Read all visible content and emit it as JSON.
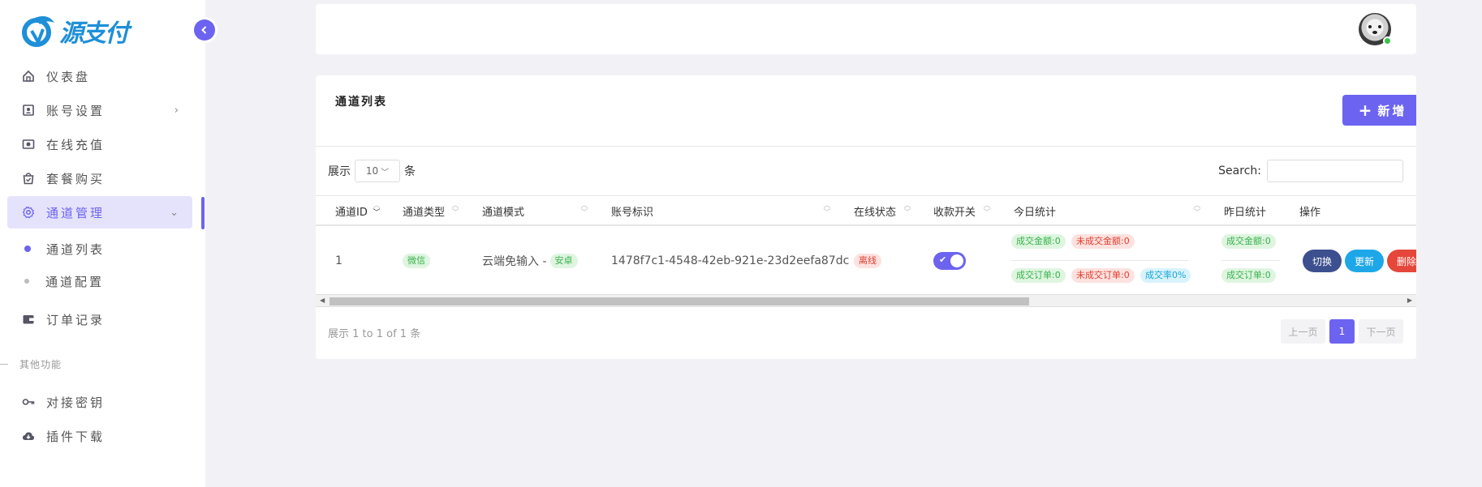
{
  "brand": {
    "logo_text": "源支付"
  },
  "sidebar": {
    "items": [
      {
        "label": "仪表盘",
        "icon": "home-icon"
      },
      {
        "label": "账号设置",
        "icon": "account-icon"
      },
      {
        "label": "在线充值",
        "icon": "recharge-icon"
      },
      {
        "label": "套餐购买",
        "icon": "shopping-bag-icon"
      },
      {
        "label": "通道管理",
        "icon": "gear-icon"
      }
    ],
    "sub_items": [
      {
        "label": "通道列表"
      },
      {
        "label": "通道配置"
      }
    ],
    "orders": {
      "label": "订单记录",
      "icon": "wallet-icon"
    },
    "section_label": "其他功能",
    "other_items": [
      {
        "label": "对接密钥",
        "icon": "key-icon"
      },
      {
        "label": "插件下载",
        "icon": "cloud-download-icon"
      }
    ]
  },
  "card": {
    "title": "通道列表",
    "add_label": "新增",
    "length_prefix": "展示",
    "length_value": "10",
    "length_suffix": "条",
    "search_label": "Search:",
    "search_value": ""
  },
  "table": {
    "columns": [
      "通道ID",
      "通道类型",
      "通道模式",
      "账号标识",
      "在线状态",
      "收款开关",
      "今日统计",
      "昨日统计",
      "操作"
    ],
    "rows": [
      {
        "id": "1",
        "type": "微信",
        "mode": "云端免输入 -",
        "mode_badge": "安卓",
        "account": "1478f7c1-4548-42eb-921e-23d2eefa87dc",
        "status": "离线",
        "switch_on": true,
        "today": {
          "amount": "成交金额:0",
          "unpaid_amount": "未成交金额:0",
          "orders": "成交订单:0",
          "unpaid_orders": "未成交订单:0",
          "rate": "成交率0%"
        },
        "yesterday": {
          "amount": "成交金额:0",
          "orders": "成交订单:0"
        },
        "actions": {
          "switch": "切换",
          "update": "更新",
          "delete": "删除"
        }
      }
    ]
  },
  "footer": {
    "info": "展示 1 to 1 of 1 条",
    "prev": "上一页",
    "current_page": "1",
    "next": "下一页"
  },
  "colors": {
    "accent": "#6c63f0",
    "switch_btn": "#3c4f8f",
    "update_btn": "#1ea7e8",
    "delete_btn": "#e5473a"
  }
}
